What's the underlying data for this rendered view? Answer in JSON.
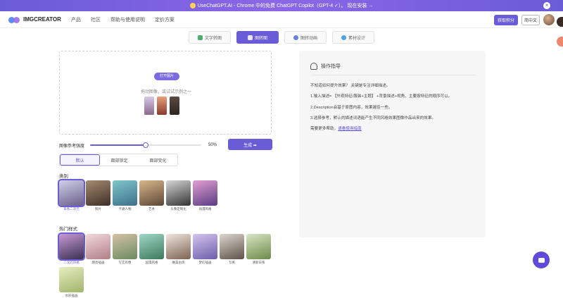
{
  "banner": {
    "text": "UseChatGPT.AI - Chrome 中的免费 ChatGPT Copilot（GPT-4 ✓）。 现在安装 →"
  },
  "header": {
    "brand": "IMGCREATOR",
    "nav": [
      "产品",
      "社区",
      "帮助与使用说明",
      "定价方案"
    ],
    "upgrade_label": "获取积分",
    "lang_label": "简中文"
  },
  "tabs": [
    {
      "label": "文字转图",
      "active": false
    },
    {
      "label": "图转图",
      "active": true
    },
    {
      "label": "图转动画",
      "active": false
    },
    {
      "label": "素材设计",
      "active": false
    }
  ],
  "upload": {
    "button": "打开图片",
    "hint": "拖动图像，或试试示例之一"
  },
  "strength": {
    "label": "图像参考强度",
    "value": 50,
    "value_text": "50%"
  },
  "generate_label": "生成 ➡",
  "modes": [
    {
      "label": "默认",
      "active": true
    },
    {
      "label": "面部锁定",
      "active": false
    },
    {
      "label": "面部变化",
      "active": false
    }
  ],
  "category": {
    "title": "类别",
    "items": [
      {
        "label": "日系二次元",
        "selected": true,
        "colors": [
          "#cfd0e8",
          "#6a5f8a"
        ]
      },
      {
        "label": "照片",
        "selected": false,
        "colors": [
          "#a58a70",
          "#3e2f27"
        ]
      },
      {
        "label": "卡通人物",
        "selected": false,
        "colors": [
          "#7fc7c9",
          "#3d6f8c"
        ]
      },
      {
        "label": "艺术",
        "selected": false,
        "colors": [
          "#d9b78b",
          "#5b4636"
        ]
      },
      {
        "label": "头像定制化",
        "selected": false,
        "colors": [
          "#d6d6d6",
          "#333333"
        ]
      },
      {
        "label": "动漫风格",
        "selected": false,
        "colors": [
          "#e29fd1",
          "#5a3b84"
        ]
      }
    ]
  },
  "styles": {
    "title": "热门样式",
    "items": [
      {
        "label": "二次元风格",
        "selected": true,
        "colors": [
          "#c69ad6",
          "#3b3050"
        ]
      },
      {
        "label": "明亮插画",
        "selected": false,
        "colors": [
          "#f2d9dc",
          "#b07e87"
        ]
      },
      {
        "label": "写实肖像",
        "selected": false,
        "colors": [
          "#d4c2a6",
          "#6b8a5f"
        ]
      },
      {
        "label": "国漫风格",
        "selected": false,
        "colors": [
          "#9fd6c7",
          "#3d7a5c"
        ]
      },
      {
        "label": "唯美古风",
        "selected": false,
        "colors": [
          "#efe6de",
          "#7d6253"
        ]
      },
      {
        "label": "梦幻插画",
        "selected": false,
        "colors": [
          "#d4c3ee",
          "#6c5eab"
        ]
      },
      {
        "label": "写真",
        "selected": false,
        "colors": [
          "#ddd7cf",
          "#5e5148"
        ]
      },
      {
        "label": "清新日系",
        "selected": false,
        "colors": [
          "#d8e6c4",
          "#6d8a4a"
        ]
      },
      {
        "label": "水彩插画",
        "selected": false,
        "colors": [
          "#e6eec0",
          "#a0b46a"
        ]
      }
    ]
  },
  "guide": {
    "title": "操作指导",
    "intro": "不知道如何提升效果？ 关键是专注详细描述。",
    "step1": "1.输入描述= 【外观特征/服装+主题】 +背景描述+视角，主要按特征的顺序可以。",
    "step2": "2.Description会基于原图内容，效果越佳一些。",
    "step3": "3.选择参考，默认的描述词语能产生不同风格效果图像作品出来的效果。",
    "more_prefix": "需要更多帮助，",
    "more_link": "请看使用指南"
  },
  "colors": {
    "accent": "#6a5bd6",
    "panel_bg": "#f7f7f8"
  }
}
